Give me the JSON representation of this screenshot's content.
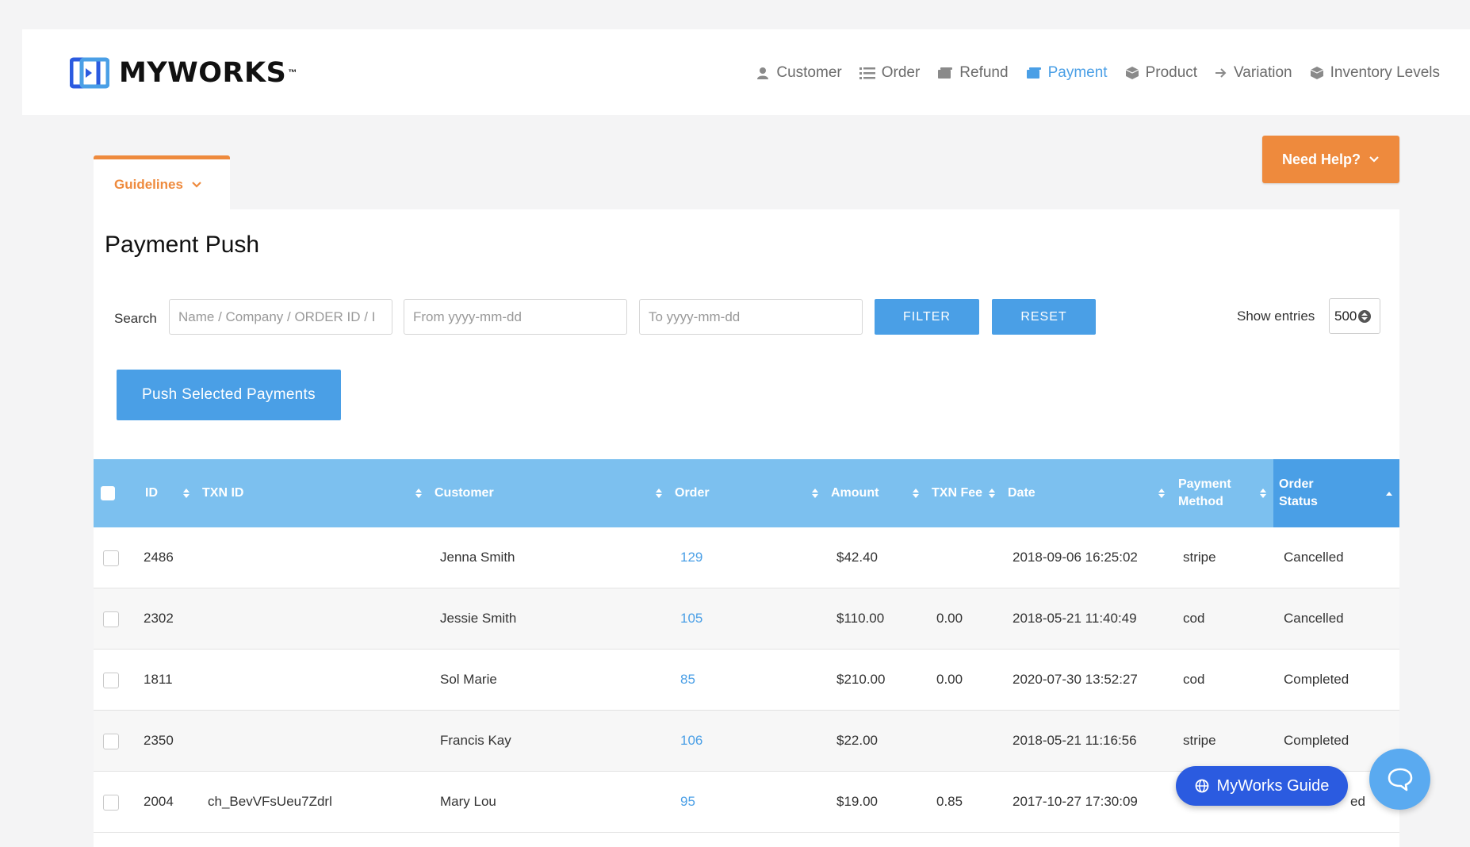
{
  "brand": {
    "name": "MYWORKS",
    "tm": "™",
    "accent": "#4a9fe6",
    "orange": "#ee8a3d"
  },
  "nav": {
    "items": [
      {
        "label": "Customer",
        "icon": "user-icon",
        "active": false
      },
      {
        "label": "Order",
        "icon": "list-icon",
        "active": false
      },
      {
        "label": "Refund",
        "icon": "refund-icon",
        "active": false
      },
      {
        "label": "Payment",
        "icon": "payment-icon",
        "active": true
      },
      {
        "label": "Product",
        "icon": "box-icon",
        "active": false
      },
      {
        "label": "Variation",
        "icon": "arrow-right-icon",
        "active": false
      },
      {
        "label": "Inventory Levels",
        "icon": "box-icon",
        "active": false
      }
    ]
  },
  "help": {
    "label": "Need Help?"
  },
  "guidelines": {
    "label": "Guidelines"
  },
  "page": {
    "title": "Payment Push"
  },
  "search": {
    "label": "Search",
    "name_placeholder": "Name / Company / ORDER ID / I",
    "from_placeholder": "From yyyy-mm-dd",
    "to_placeholder": "To yyyy-mm-dd",
    "filter_label": "FILTER",
    "reset_label": "RESET"
  },
  "entries": {
    "label": "Show entries",
    "value": "500"
  },
  "push_button": {
    "label": "Push Selected Payments"
  },
  "table": {
    "headers": {
      "id": "ID",
      "txn_id": "TXN ID",
      "customer": "Customer",
      "order": "Order",
      "amount": "Amount",
      "txn_fee": "TXN Fee",
      "date": "Date",
      "payment_method_1": "Payment",
      "payment_method_2": "Method",
      "order_status_1": "Order",
      "order_status_2": "Status"
    },
    "rows": [
      {
        "id": "2486",
        "txn_id": "",
        "customer": "Jenna Smith",
        "order": "129",
        "amount": "$42.40",
        "txn_fee": "",
        "date": "2018-09-06 16:25:02",
        "method": "stripe",
        "status": "Cancelled"
      },
      {
        "id": "2302",
        "txn_id": "",
        "customer": "Jessie Smith",
        "order": "105",
        "amount": "$110.00",
        "txn_fee": "0.00",
        "date": "2018-05-21 11:40:49",
        "method": "cod",
        "status": "Cancelled"
      },
      {
        "id": "1811",
        "txn_id": "",
        "customer": "Sol Marie",
        "order": "85",
        "amount": "$210.00",
        "txn_fee": "0.00",
        "date": "2020-07-30 13:52:27",
        "method": "cod",
        "status": "Completed"
      },
      {
        "id": "2350",
        "txn_id": "",
        "customer": "Francis Kay",
        "order": "106",
        "amount": "$22.00",
        "txn_fee": "",
        "date": "2018-05-21 11:16:56",
        "method": "stripe",
        "status": "Completed"
      },
      {
        "id": "2004",
        "txn_id": "ch_BevVFsUeu7Zdrl",
        "customer": "Mary Lou",
        "order": "95",
        "amount": "$19.00",
        "txn_fee": "0.85",
        "date": "2017-10-27 17:30:09",
        "method": "",
        "status": "ed"
      }
    ]
  },
  "guide_pill": {
    "label": "MyWorks Guide"
  }
}
